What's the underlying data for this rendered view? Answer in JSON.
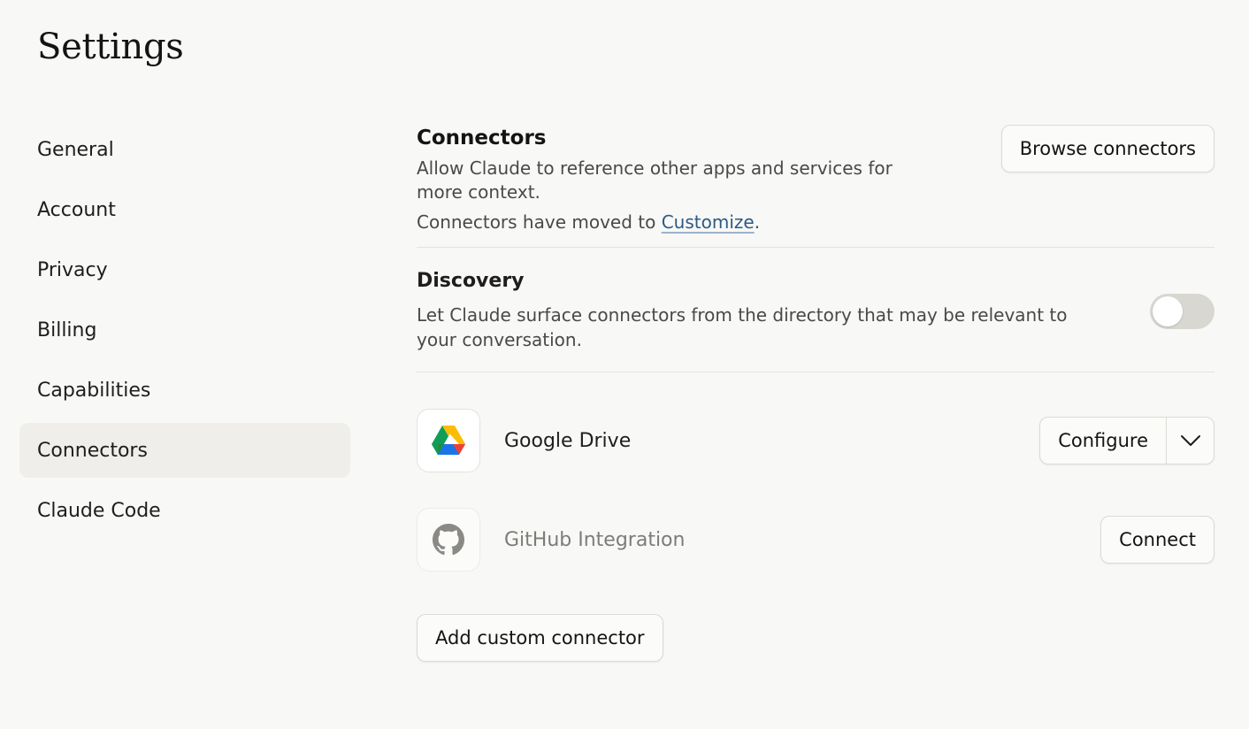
{
  "page": {
    "title": "Settings"
  },
  "sidebar": {
    "items": [
      {
        "label": "General"
      },
      {
        "label": "Account"
      },
      {
        "label": "Privacy"
      },
      {
        "label": "Billing"
      },
      {
        "label": "Capabilities"
      },
      {
        "label": "Connectors",
        "active": true
      },
      {
        "label": "Claude Code"
      }
    ]
  },
  "connectors": {
    "title": "Connectors",
    "description": "Allow Claude to reference other apps and services for more context.",
    "moved_prefix": "Connectors have moved to ",
    "moved_link": "Customize",
    "moved_suffix": ".",
    "browse_label": "Browse connectors"
  },
  "discovery": {
    "title": "Discovery",
    "description": "Let Claude surface connectors from the directory that may be relevant to your conversation.",
    "enabled": false
  },
  "apps": [
    {
      "name": "Google Drive",
      "icon": "google-drive-icon",
      "action_label": "Configure",
      "has_dropdown": true,
      "connected": true
    },
    {
      "name": "GitHub Integration",
      "icon": "github-icon",
      "action_label": "Connect",
      "has_dropdown": false,
      "connected": false
    }
  ],
  "add_custom_label": "Add custom connector",
  "colors": {
    "background": "#f8f8f6",
    "active_nav": "#efeeea",
    "link": "#2d5a86",
    "toggle_off": "#d8d7d2"
  }
}
